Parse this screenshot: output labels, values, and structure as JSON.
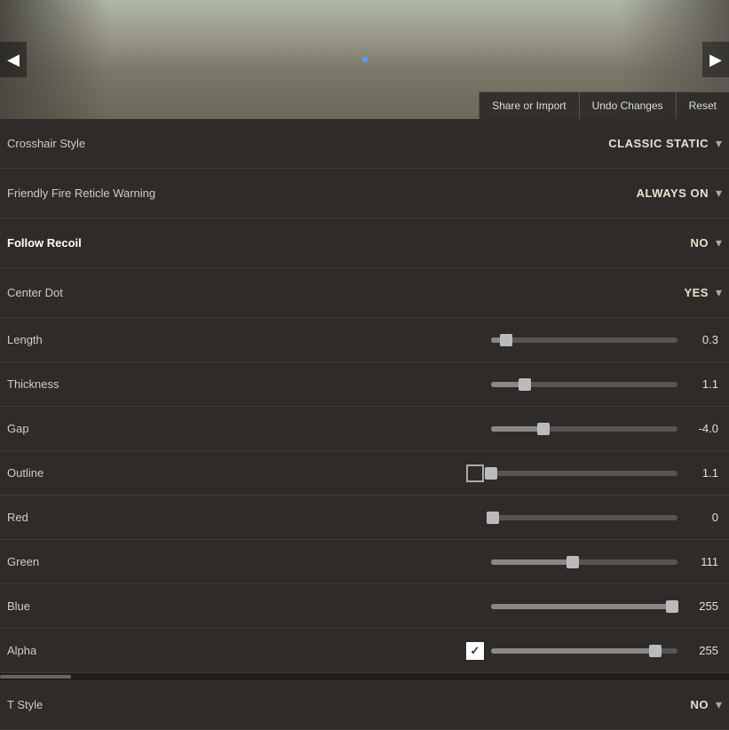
{
  "hero": {
    "prev_label": "◀",
    "next_label": "▶",
    "share_import_label": "Share or Import",
    "undo_changes_label": "Undo Changes",
    "reset_label": "Reset"
  },
  "settings": {
    "crosshair_style": {
      "label": "Crosshair Style",
      "value": "CLASSIC STATIC",
      "chevron": "▾"
    },
    "friendly_fire": {
      "label": "Friendly Fire Reticle Warning",
      "value": "ALWAYS ON",
      "chevron": "▾"
    },
    "follow_recoil": {
      "label": "Follow Recoil",
      "value": "NO",
      "chevron": "▾"
    },
    "center_dot": {
      "label": "Center Dot",
      "value": "YES",
      "chevron": "▾"
    },
    "length": {
      "label": "Length",
      "value": "0.3",
      "fill_pct": 8,
      "thumb_pct": 8
    },
    "thickness": {
      "label": "Thickness",
      "value": "1.1",
      "fill_pct": 18,
      "thumb_pct": 18
    },
    "gap": {
      "label": "Gap",
      "value": "-4.0",
      "fill_pct": 28,
      "thumb_pct": 28
    },
    "outline": {
      "label": "Outline",
      "value": "1.1",
      "fill_pct": 0,
      "thumb_pct": 0,
      "has_checkbox": true,
      "checked": false
    },
    "red": {
      "label": "Red",
      "value": "0",
      "fill_pct": 1,
      "thumb_pct": 1
    },
    "green": {
      "label": "Green",
      "value": "111",
      "fill_pct": 42,
      "thumb_pct": 42
    },
    "blue": {
      "label": "Blue",
      "value": "255",
      "fill_pct": 100,
      "thumb_pct": 100
    },
    "alpha": {
      "label": "Alpha",
      "value": "255",
      "fill_pct": 88,
      "thumb_pct": 88,
      "has_checkbox": true,
      "checked": true
    },
    "t_style": {
      "label": "T Style",
      "value": "NO",
      "chevron": "▾"
    }
  }
}
